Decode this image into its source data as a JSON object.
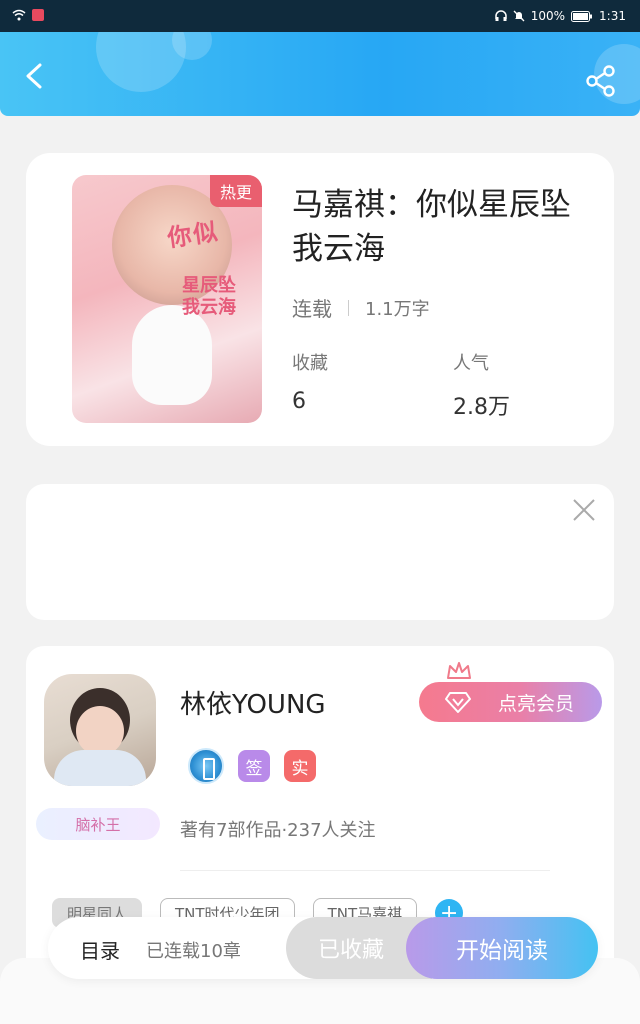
{
  "status_bar": {
    "battery": "100%",
    "time": "1:31"
  },
  "book": {
    "hot_tag": "热更",
    "title": "马嘉祺：你似星辰坠我云海",
    "status": "连载",
    "word_count": "1.1万字",
    "favorites_label": "收藏",
    "favorites_value": "6",
    "popularity_label": "人气",
    "popularity_value": "2.8万",
    "cover_text": [
      "你似",
      "星辰坠我云海"
    ]
  },
  "author": {
    "name": "林依YOUNG",
    "badge_sign": "签",
    "badge_real": "实",
    "vip_button": "点亮会员",
    "title_tag": "脑补王",
    "works_info": "著有7部作品·237人关注",
    "tags": [
      "明星同人",
      "TNT时代少年团",
      "TNT马嘉祺"
    ],
    "add_tag": "+"
  },
  "bottom_bar": {
    "toc": "目录",
    "chapter_info": "已连载10章",
    "favorited": "已收藏",
    "start_reading": "开始阅读"
  },
  "colors": {
    "header": "#27a7f4",
    "hot_tag": "#e95f6f",
    "vip_start": "#f57a8e",
    "vip_end": "#b99ae9",
    "read_end": "#44c2f2"
  }
}
